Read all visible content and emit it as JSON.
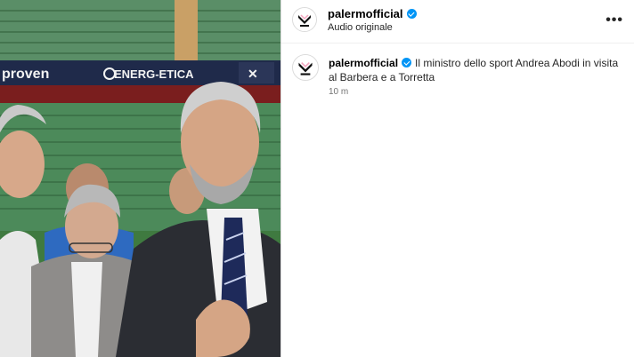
{
  "post": {
    "username": "palermofficial",
    "audio_label": "Audio originale",
    "more_icon": "more-horizontal-icon",
    "caption": {
      "username": "palermofficial",
      "text": "Il ministro dello sport Andrea Abodi in visita al Barbera e a Torretta",
      "time": "10 m"
    }
  },
  "media": {
    "banner_left": "proven",
    "banner_right": "ENERG-ETICA"
  },
  "colors": {
    "verified": "#0095f6",
    "pitch": "#3c7a45",
    "stands": "#4f8a5c"
  }
}
